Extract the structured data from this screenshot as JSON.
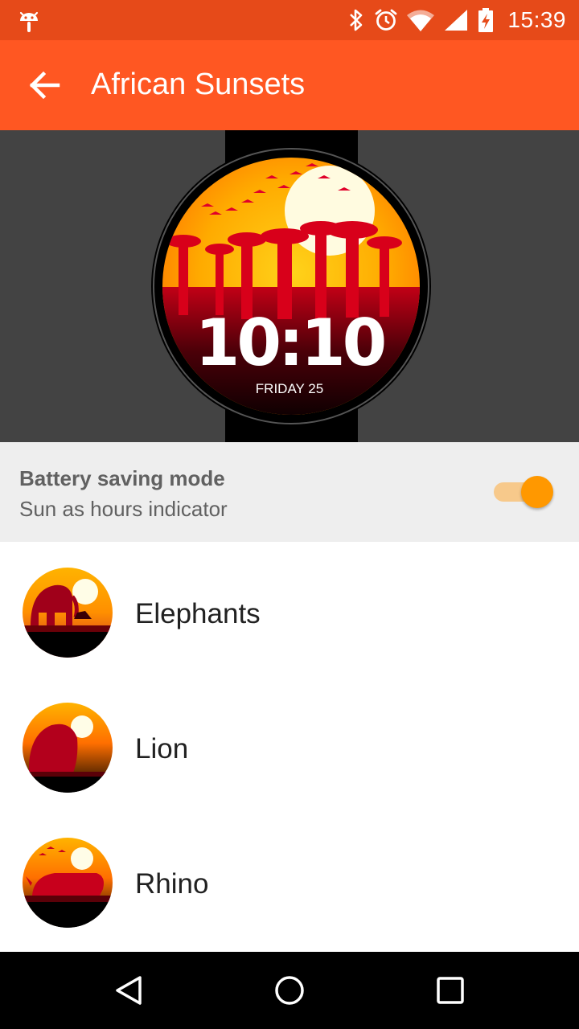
{
  "status_bar": {
    "time": "15:39",
    "icons": [
      "android-icon",
      "bluetooth-icon",
      "alarm-icon",
      "wifi-icon",
      "signal-icon",
      "battery-charging-icon"
    ]
  },
  "app_bar": {
    "title": "African Sunsets",
    "back_icon": "arrow-back-icon"
  },
  "preview": {
    "time": "10:10",
    "date": "FRIDAY 25"
  },
  "setting": {
    "label": "Battery saving mode",
    "sublabel": "Sun as hours indicator",
    "enabled": true
  },
  "faces": [
    {
      "name": "Elephants"
    },
    {
      "name": "Lion"
    },
    {
      "name": "Rhino"
    }
  ],
  "nav_bar": {
    "icons": [
      "back-triangle-icon",
      "home-circle-icon",
      "recents-square-icon"
    ]
  },
  "colors": {
    "status_bar": "#e64a19",
    "app_bar": "#ff5722",
    "accent": "#ff9800"
  }
}
